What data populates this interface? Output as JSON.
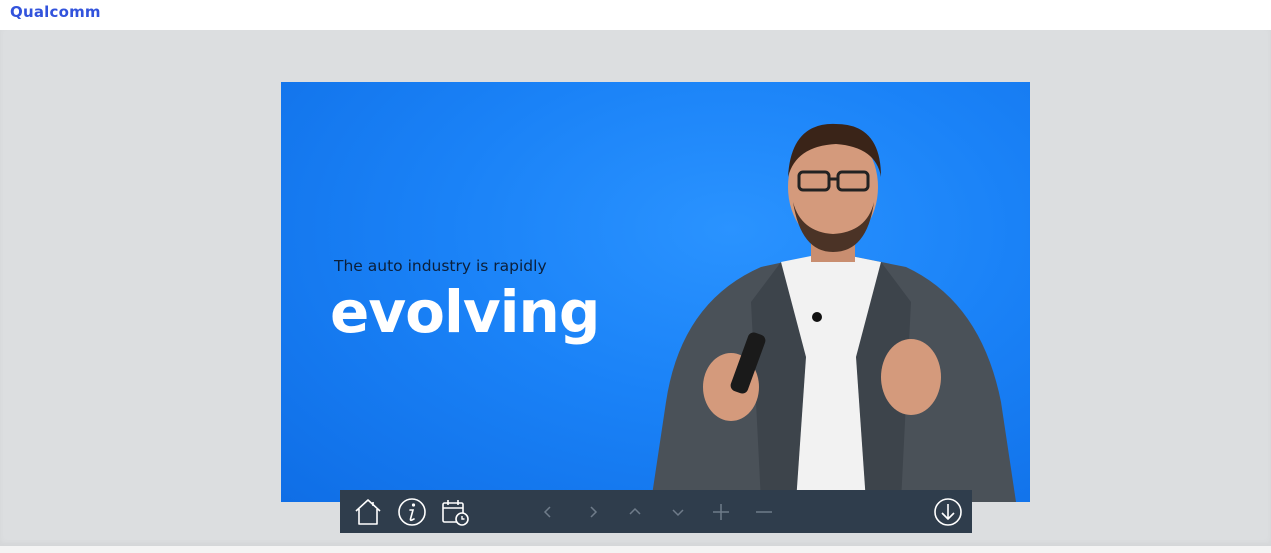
{
  "header": {
    "logo_text": "Qualcomm"
  },
  "slide": {
    "subtitle": "The auto industry is rapidly",
    "title": "evolving"
  },
  "toolbar": {
    "buttons": [
      {
        "icon": "home-icon"
      },
      {
        "icon": "info-icon"
      },
      {
        "icon": "calendar-clock-icon"
      },
      {
        "icon": "chevron-left-icon"
      },
      {
        "icon": "chevron-right-icon"
      },
      {
        "icon": "chevron-up-icon"
      },
      {
        "icon": "chevron-down-icon"
      },
      {
        "icon": "plus-icon"
      },
      {
        "icon": "minus-icon"
      },
      {
        "icon": "download-icon"
      }
    ]
  },
  "colors": {
    "brand": "#3253dc",
    "slide_bg": "#1a82f7",
    "toolbar_bg": "#2f3d4c",
    "stage_bg": "#dcdee0"
  }
}
